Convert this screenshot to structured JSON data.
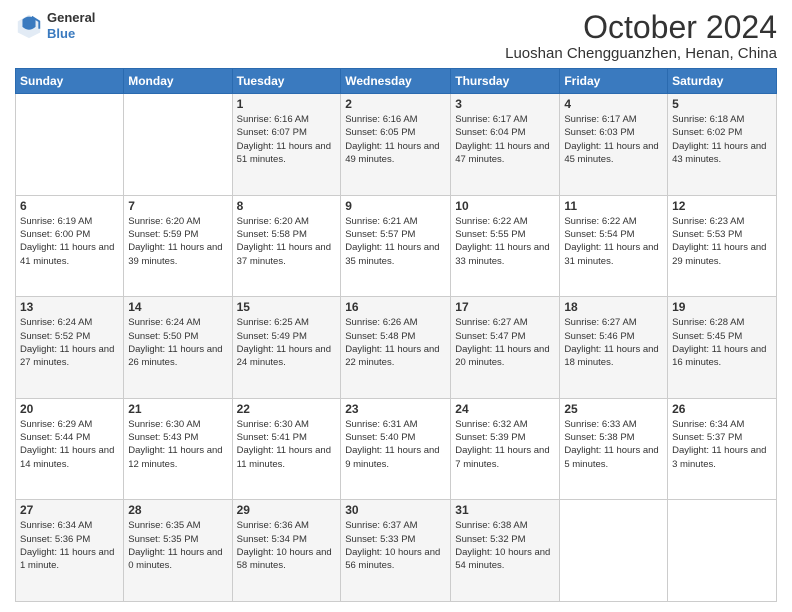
{
  "header": {
    "logo_line1": "General",
    "logo_line2": "Blue",
    "month": "October 2024",
    "location": "Luoshan Chengguanzhen, Henan, China"
  },
  "weekdays": [
    "Sunday",
    "Monday",
    "Tuesday",
    "Wednesday",
    "Thursday",
    "Friday",
    "Saturday"
  ],
  "weeks": [
    [
      {
        "day": "",
        "info": ""
      },
      {
        "day": "",
        "info": ""
      },
      {
        "day": "1",
        "info": "Sunrise: 6:16 AM\nSunset: 6:07 PM\nDaylight: 11 hours and 51 minutes."
      },
      {
        "day": "2",
        "info": "Sunrise: 6:16 AM\nSunset: 6:05 PM\nDaylight: 11 hours and 49 minutes."
      },
      {
        "day": "3",
        "info": "Sunrise: 6:17 AM\nSunset: 6:04 PM\nDaylight: 11 hours and 47 minutes."
      },
      {
        "day": "4",
        "info": "Sunrise: 6:17 AM\nSunset: 6:03 PM\nDaylight: 11 hours and 45 minutes."
      },
      {
        "day": "5",
        "info": "Sunrise: 6:18 AM\nSunset: 6:02 PM\nDaylight: 11 hours and 43 minutes."
      }
    ],
    [
      {
        "day": "6",
        "info": "Sunrise: 6:19 AM\nSunset: 6:00 PM\nDaylight: 11 hours and 41 minutes."
      },
      {
        "day": "7",
        "info": "Sunrise: 6:20 AM\nSunset: 5:59 PM\nDaylight: 11 hours and 39 minutes."
      },
      {
        "day": "8",
        "info": "Sunrise: 6:20 AM\nSunset: 5:58 PM\nDaylight: 11 hours and 37 minutes."
      },
      {
        "day": "9",
        "info": "Sunrise: 6:21 AM\nSunset: 5:57 PM\nDaylight: 11 hours and 35 minutes."
      },
      {
        "day": "10",
        "info": "Sunrise: 6:22 AM\nSunset: 5:55 PM\nDaylight: 11 hours and 33 minutes."
      },
      {
        "day": "11",
        "info": "Sunrise: 6:22 AM\nSunset: 5:54 PM\nDaylight: 11 hours and 31 minutes."
      },
      {
        "day": "12",
        "info": "Sunrise: 6:23 AM\nSunset: 5:53 PM\nDaylight: 11 hours and 29 minutes."
      }
    ],
    [
      {
        "day": "13",
        "info": "Sunrise: 6:24 AM\nSunset: 5:52 PM\nDaylight: 11 hours and 27 minutes."
      },
      {
        "day": "14",
        "info": "Sunrise: 6:24 AM\nSunset: 5:50 PM\nDaylight: 11 hours and 26 minutes."
      },
      {
        "day": "15",
        "info": "Sunrise: 6:25 AM\nSunset: 5:49 PM\nDaylight: 11 hours and 24 minutes."
      },
      {
        "day": "16",
        "info": "Sunrise: 6:26 AM\nSunset: 5:48 PM\nDaylight: 11 hours and 22 minutes."
      },
      {
        "day": "17",
        "info": "Sunrise: 6:27 AM\nSunset: 5:47 PM\nDaylight: 11 hours and 20 minutes."
      },
      {
        "day": "18",
        "info": "Sunrise: 6:27 AM\nSunset: 5:46 PM\nDaylight: 11 hours and 18 minutes."
      },
      {
        "day": "19",
        "info": "Sunrise: 6:28 AM\nSunset: 5:45 PM\nDaylight: 11 hours and 16 minutes."
      }
    ],
    [
      {
        "day": "20",
        "info": "Sunrise: 6:29 AM\nSunset: 5:44 PM\nDaylight: 11 hours and 14 minutes."
      },
      {
        "day": "21",
        "info": "Sunrise: 6:30 AM\nSunset: 5:43 PM\nDaylight: 11 hours and 12 minutes."
      },
      {
        "day": "22",
        "info": "Sunrise: 6:30 AM\nSunset: 5:41 PM\nDaylight: 11 hours and 11 minutes."
      },
      {
        "day": "23",
        "info": "Sunrise: 6:31 AM\nSunset: 5:40 PM\nDaylight: 11 hours and 9 minutes."
      },
      {
        "day": "24",
        "info": "Sunrise: 6:32 AM\nSunset: 5:39 PM\nDaylight: 11 hours and 7 minutes."
      },
      {
        "day": "25",
        "info": "Sunrise: 6:33 AM\nSunset: 5:38 PM\nDaylight: 11 hours and 5 minutes."
      },
      {
        "day": "26",
        "info": "Sunrise: 6:34 AM\nSunset: 5:37 PM\nDaylight: 11 hours and 3 minutes."
      }
    ],
    [
      {
        "day": "27",
        "info": "Sunrise: 6:34 AM\nSunset: 5:36 PM\nDaylight: 11 hours and 1 minute."
      },
      {
        "day": "28",
        "info": "Sunrise: 6:35 AM\nSunset: 5:35 PM\nDaylight: 11 hours and 0 minutes."
      },
      {
        "day": "29",
        "info": "Sunrise: 6:36 AM\nSunset: 5:34 PM\nDaylight: 10 hours and 58 minutes."
      },
      {
        "day": "30",
        "info": "Sunrise: 6:37 AM\nSunset: 5:33 PM\nDaylight: 10 hours and 56 minutes."
      },
      {
        "day": "31",
        "info": "Sunrise: 6:38 AM\nSunset: 5:32 PM\nDaylight: 10 hours and 54 minutes."
      },
      {
        "day": "",
        "info": ""
      },
      {
        "day": "",
        "info": ""
      }
    ]
  ]
}
